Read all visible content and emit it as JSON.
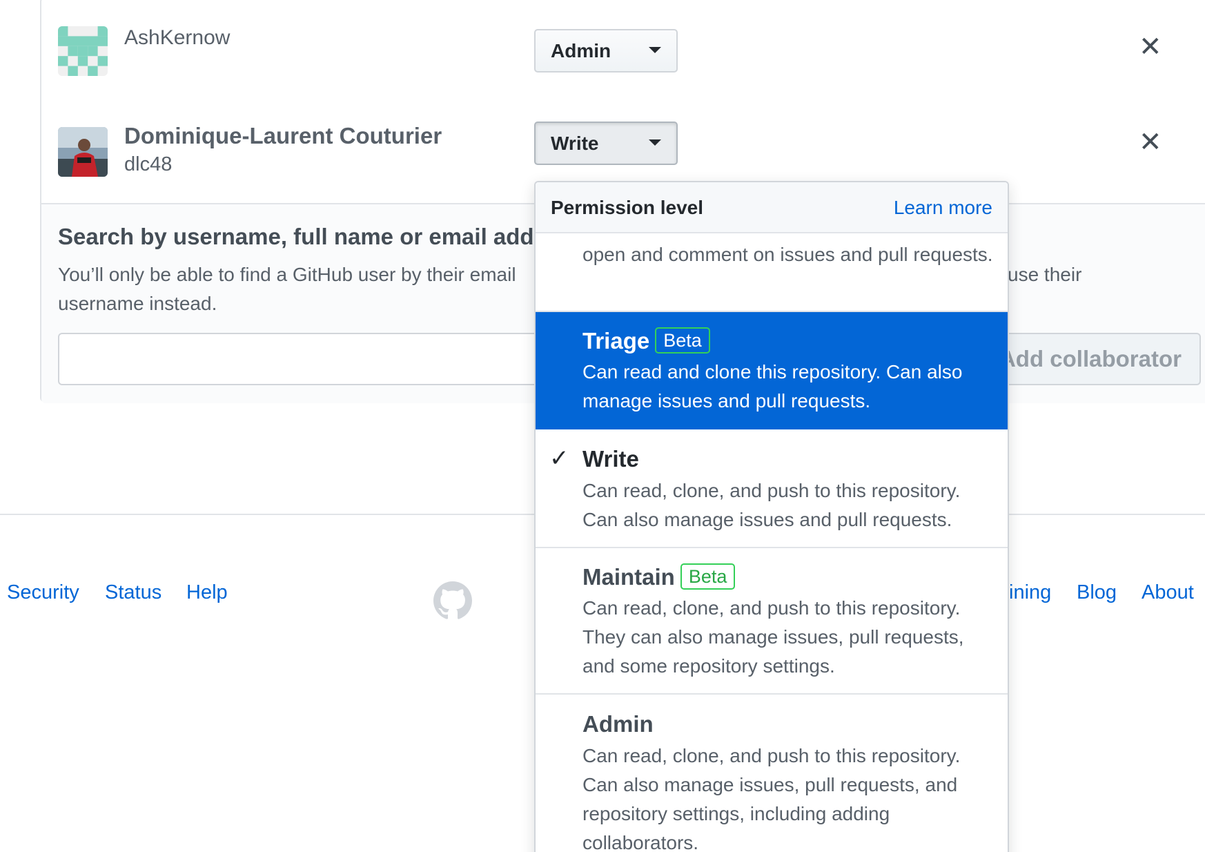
{
  "collaborators": [
    {
      "name": "AshKernow",
      "login": "",
      "permission": "Admin"
    },
    {
      "name": "Dominique-Laurent Couturier",
      "login": "dlc48",
      "permission": "Write"
    }
  ],
  "search": {
    "title": "Search by username, full name or email address",
    "help_left": "You’ll only be able to find a GitHub user by their email",
    "help_right": "use their",
    "help_line2": "username instead.",
    "add_button": "Add collaborator"
  },
  "footer": {
    "security": "Security",
    "status": "Status",
    "help": "Help",
    "training_partial": "ining",
    "blog": "Blog",
    "about": "About"
  },
  "dropdown": {
    "title": "Permission level",
    "learn_more": "Learn more",
    "items": [
      {
        "title": "",
        "beta": "",
        "desc": "open and comment on issues and pull requests."
      },
      {
        "title": "Triage",
        "beta": "Beta",
        "desc": "Can read and clone this repository. Can also manage issues and pull requests."
      },
      {
        "title": "Write",
        "beta": "",
        "desc": "Can read, clone, and push to this repository. Can also manage issues and pull requests."
      },
      {
        "title": "Maintain",
        "beta": "Beta",
        "desc": "Can read, clone, and push to this repository. They can also manage issues, pull requests, and some repository settings."
      },
      {
        "title": "Admin",
        "beta": "",
        "desc": "Can read, clone, and push to this repository. Can also manage issues, pull requests, and repository settings, including adding collaborators."
      }
    ],
    "check_glyph": "✓"
  },
  "icons": {
    "remove": "✕"
  },
  "colors": {
    "highlight": "#0366d6",
    "link": "#0366d6",
    "beta_border": "#34d058",
    "identicon": "#7fd3bf"
  }
}
